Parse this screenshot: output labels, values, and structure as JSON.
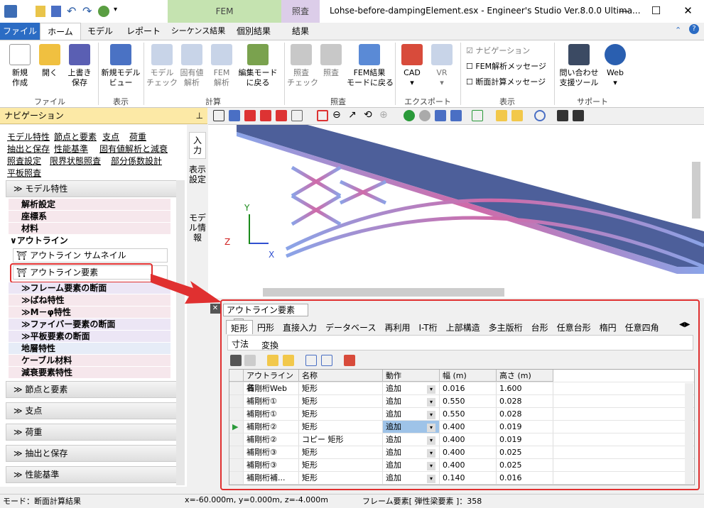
{
  "window": {
    "title": "Lohse-before-dampingElement.esx - Engineer's Studio Ver.8.0.0 Ultima...",
    "context_tabs": [
      "FEM",
      "照査"
    ],
    "context_subtabs": [
      "シーケンス結果",
      "個別結果",
      "結果"
    ]
  },
  "ribbon_tabs": [
    "ファイル",
    "ホーム",
    "モデル",
    "レポート"
  ],
  "ribbon": {
    "buttons": [
      "新規\n作成",
      "開く",
      "上書き\n保存",
      "新規モデル\nビュー",
      "モデル\nチェック",
      "固有値\n解析",
      "FEM\n解析",
      "編集モード\nに戻る",
      "照査\nチェック",
      "照査",
      "FEM結果\nモードに戻る",
      "CAD",
      "VR",
      "問い合わせ\n支援ツール",
      "Web"
    ],
    "groups": [
      "ファイル",
      "表示",
      "計算",
      "照査",
      "エクスポート",
      "表示",
      "サポート"
    ],
    "checks": [
      {
        "label": "ナビゲーション",
        "checked": true
      },
      {
        "label": "FEM解析メッセージ",
        "checked": false
      },
      {
        "label": "断面計算メッセージ",
        "checked": false
      }
    ]
  },
  "nav": {
    "title": "ナビゲーション",
    "links": [
      "モデル特性",
      "節点と要素",
      "支点",
      "荷重",
      "抽出と保存",
      "性能基準",
      "固有値解析と減衰",
      "照査設定",
      "限界状態照査",
      "部分係数設計",
      "平板照査"
    ],
    "section_top": "モデル特性",
    "items": [
      "解析設定",
      "座標系",
      "材料",
      "アウトライン",
      "アウトライン サムネイル",
      "アウトライン要素",
      "フレーム要素の断面",
      "ばね特性",
      "M－φ特性",
      "ファイバー要素の断面",
      "平板要素の断面",
      "地層特性",
      "ケーブル材料",
      "減衰要素特性"
    ],
    "sections": [
      "節点と要素",
      "支点",
      "荷重",
      "抽出と保存",
      "性能基準"
    ],
    "vtabs": [
      "入力",
      "表示設定",
      "モデル情報"
    ]
  },
  "axes": {
    "x": "X",
    "y": "Y",
    "z": "Z"
  },
  "panel": {
    "title": "アウトライン要素",
    "tabs": [
      "矩形",
      "円形",
      "直接入力",
      "データベース",
      "再利用",
      "I-T桁",
      "上部構造",
      "多主版桁",
      "台形",
      "任意台形",
      "楕円",
      "任意四角",
      "..."
    ],
    "subtabs": [
      "寸法",
      "変換"
    ],
    "columns": [
      "アウトライン名",
      "名称",
      "動作",
      "幅 (m)",
      "高さ (m)"
    ],
    "rows": [
      [
        "補剛桁Web",
        "矩形",
        "追加",
        "0.016",
        "1.600"
      ],
      [
        "補剛桁①",
        "矩形",
        "追加",
        "0.550",
        "0.028"
      ],
      [
        "補剛桁①",
        "矩形",
        "追加",
        "0.550",
        "0.028"
      ],
      [
        "補剛桁②",
        "矩形",
        "追加",
        "0.400",
        "0.019"
      ],
      [
        "補剛桁②",
        "コピー 矩形",
        "追加",
        "0.400",
        "0.019"
      ],
      [
        "補剛桁③",
        "矩形",
        "追加",
        "0.400",
        "0.025"
      ],
      [
        "補剛桁③",
        "矩形",
        "追加",
        "0.400",
        "0.025"
      ],
      [
        "補剛桁補...",
        "矩形",
        "追加",
        "0.140",
        "0.016"
      ]
    ],
    "selected_row": 3
  },
  "status": {
    "mode": "モード：断面計算結果",
    "coords": "x=-60.000m, y=0.000m, z=-4.000m",
    "element": "フレーム要素[ 弾性梁要素 ]：358"
  },
  "colors": {
    "accent": "#2b6cc4",
    "fem": "#c5e3b0",
    "shoken": "#dccde9",
    "nav": "#fce9a6",
    "highlight": "#e03030"
  }
}
